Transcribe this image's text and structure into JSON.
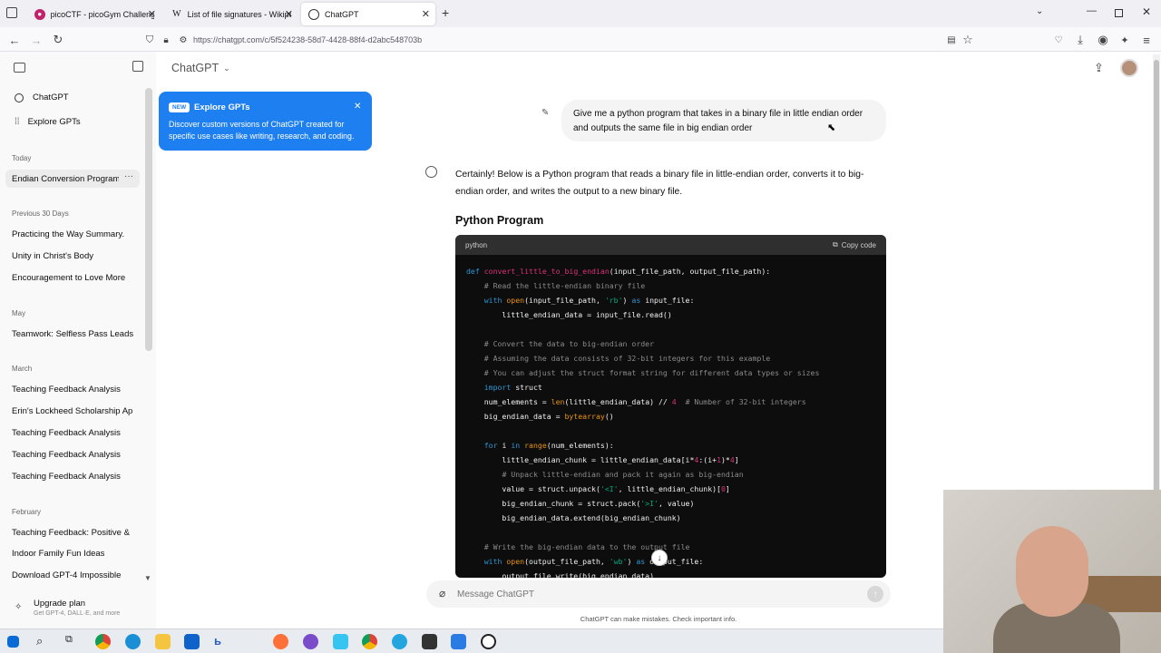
{
  "browser": {
    "tabs": [
      {
        "title": "picoCTF - picoGym Challenges",
        "active": false
      },
      {
        "title": "List of file signatures - Wikipedia",
        "active": false
      },
      {
        "title": "ChatGPT",
        "active": true
      }
    ],
    "url": "https://chatgpt.com/c/5f524238-58d7-4428-88f4-d2abc548703b"
  },
  "sidebar": {
    "top_items": [
      {
        "label": "ChatGPT"
      },
      {
        "label": "Explore GPTs"
      }
    ],
    "sections": [
      {
        "heading": "Today",
        "items": [
          "Endian Conversion Program"
        ]
      },
      {
        "heading": "Previous 30 Days",
        "items": [
          "Practicing the Way Summary.",
          "Unity in Christ's Body",
          "Encouragement to Love More"
        ]
      },
      {
        "heading": "May",
        "items": [
          "Teamwork: Selfless Pass Leads"
        ]
      },
      {
        "heading": "March",
        "items": [
          "Teaching Feedback Analysis",
          "Erin's Lockheed Scholarship Appl",
          "Teaching Feedback Analysis",
          "Teaching Feedback Analysis",
          "Teaching Feedback Analysis"
        ]
      },
      {
        "heading": "February",
        "items": [
          "Teaching Feedback: Positive & Ne",
          "Indoor Family Fun Ideas",
          "Download GPT-4 Impossible"
        ]
      }
    ],
    "upgrade": {
      "title": "Upgrade plan",
      "subtitle": "Get GPT-4, DALL·E, and more"
    }
  },
  "header": {
    "model": "ChatGPT"
  },
  "explore_popup": {
    "badge": "NEW",
    "title": "Explore GPTs",
    "body": "Discover custom versions of ChatGPT created for specific use cases like writing, research, and coding."
  },
  "conversation": {
    "user_message": "Give me a python program that takes in a binary file in little endian order and outputs the same file in big endian order",
    "assistant_intro": "Certainly! Below is a Python program that reads a binary file in little-endian order, converts it to big-endian order, and writes the output to a new binary file.",
    "section_heading": "Python Program",
    "code_language": "python",
    "copy_label": "Copy code"
  },
  "composer": {
    "placeholder": "Message ChatGPT",
    "disclaimer": "ChatGPT can make mistakes. Check important info."
  },
  "colors": {
    "popup_blue": "#1e7ff0",
    "code_bg": "#0d0d0d",
    "sidebar_bg": "#f9f9f9"
  }
}
